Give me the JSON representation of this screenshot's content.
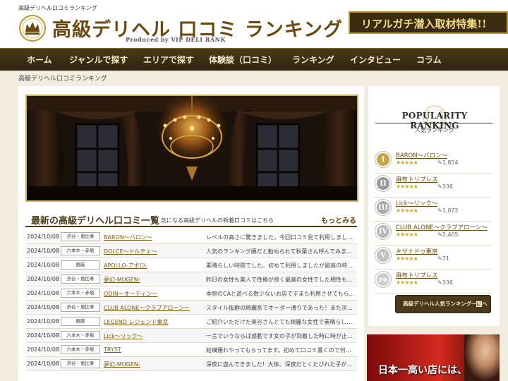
{
  "header": {
    "tiny_site_name": "高級デリヘル口コミランキング",
    "title": "高級デリヘル 口コミ ランキング",
    "subtitle": "Produced by VIP DELI RANK",
    "feature_banner": "リアルガチ潜入取材特集!!"
  },
  "nav": {
    "items": [
      {
        "label": "ホーム"
      },
      {
        "label": "ジャンルで探す"
      },
      {
        "label": "エリアで探す"
      },
      {
        "label": "体験談（口コミ）"
      },
      {
        "label": "ランキング"
      },
      {
        "label": "インタビュー"
      },
      {
        "label": "コラム"
      }
    ]
  },
  "breadcrumb": "高級デリヘル口コミランキング",
  "latest": {
    "title": "最新の高級デリヘル口コミ一覧",
    "description": "気になる高級デリヘルの新着口コミはこちら",
    "more_label": "もっとみる",
    "rows": [
      {
        "date": "2024/10/08",
        "area": "渋谷・恵比寿",
        "shop": "BARON〜バロン〜",
        "review": "レベルの高さに驚きました。今回口コミ見て利用しました…"
      },
      {
        "date": "2024/10/08",
        "area": "六本木・赤坂",
        "shop": "DOLCE〜ドルチェ〜",
        "review": "人気のランキング嬢だと勧められて秋葉さん呼んでみまし…"
      },
      {
        "date": "2024/10/08",
        "area": "銀座",
        "shop": "APOLLO-アポロ-",
        "review": "素晴らしい時間でした。初めて利用しましたが最高の時間…"
      },
      {
        "date": "2024/10/08",
        "area": "渋谷・恵比寿",
        "shop": "夢幻-MUGEN-",
        "review": "昨日の女性も美人で性格が良く最高の女性でした相性も良…"
      },
      {
        "date": "2024/10/08",
        "area": "六本木・赤坂",
        "shop": "ODIN〜オーディン〜",
        "review": "本物のCAと遊べる数少ないお店ですまた利用させてもらい…"
      },
      {
        "date": "2024/10/08",
        "area": "渋谷・恵比寿",
        "shop": "CLUB ALONE〜クラブアローン〜",
        "review": "スタイル抜群の綺麗系でオーダー通りであった！また次回…"
      },
      {
        "date": "2024/10/08",
        "area": "銀座",
        "shop": "LEGEND レジェンド東京",
        "review": "ご紹介いただけた楽谷さんとても綺麗な女性で素晴らしか…"
      },
      {
        "date": "2024/10/08",
        "area": "六本木・赤坂",
        "shop": "Lick〜リック〜",
        "review": "一言でいうならば感動です女の子が到着した時に時が止ま…"
      },
      {
        "date": "2024/10/08",
        "area": "六本木・赤坂",
        "shop": "TRYST",
        "review": "結構優れやってもらってます。初めて口コミ書くので何をか…"
      },
      {
        "date": "2024/10/08",
        "area": "渋谷・恵比寿",
        "shop": "夢幻-MUGEN-",
        "review": "深夜に遊んできました！大体、深夜だとくたびれた子が来…"
      }
    ]
  },
  "ranking": {
    "title": "POPULARITY RANKING",
    "subtitle": "人気ランキング",
    "items": [
      {
        "badge": "I",
        "name": "BARON〜バロン〜",
        "stars": "★★★★★",
        "count": "1,854",
        "color": "#c9a442"
      },
      {
        "badge": "II",
        "name": "麻布トリプレス",
        "stars": "★★★★★",
        "count": "336",
        "color": "#9a9a9a"
      },
      {
        "badge": "III",
        "name": "Lick〜リック〜",
        "stars": "★★★★★",
        "count": "1,072",
        "color": "#a9a9a9"
      },
      {
        "badge": "IV",
        "name": "CLUB ALONE〜クラブアローン〜",
        "stars": "★★★★★",
        "count": "2,405",
        "color": "#b8b8b8"
      },
      {
        "badge": "V",
        "name": "キサナドゥ東京",
        "stars": "★★★★★",
        "count": "71",
        "color": "#c2c2c2"
      },
      {
        "badge": "PR",
        "name": "麻布トリプレス",
        "stars": "★★★★★",
        "count": "336",
        "color": "#cccccc"
      }
    ],
    "button_label": "高級デリヘル人気ランキング一覧へ"
  },
  "ad": {
    "text": "日本一高い店には、"
  },
  "colors": {
    "gold": "#b9962f",
    "dark_brown": "#4a3a1a",
    "link": "#6a4a12",
    "star": "#d4a820"
  }
}
